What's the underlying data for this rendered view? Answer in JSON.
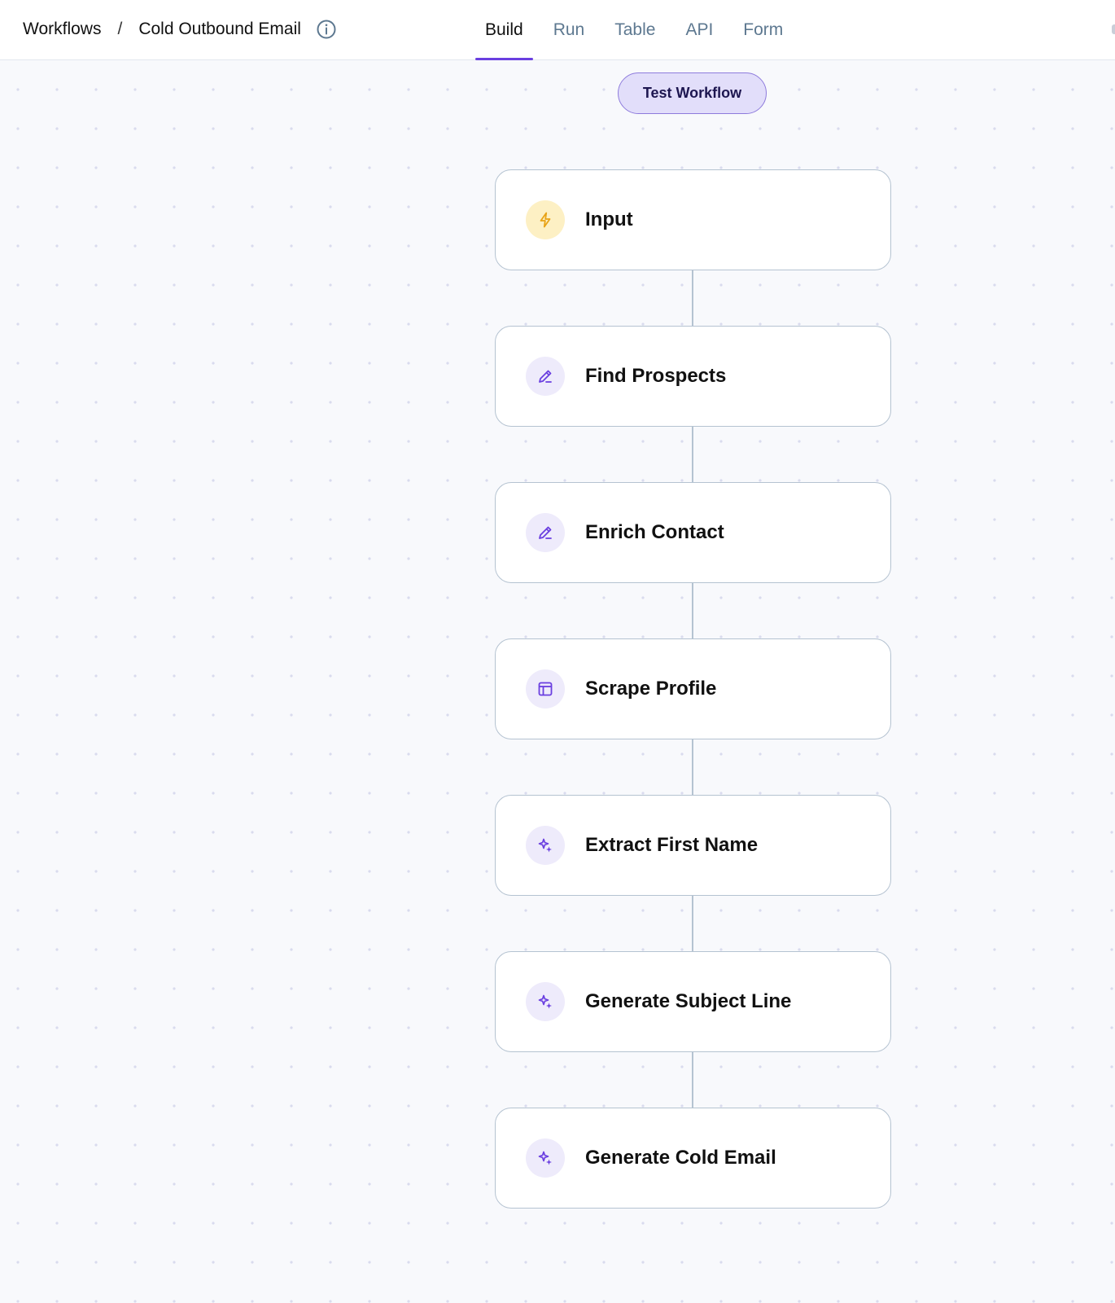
{
  "breadcrumb": {
    "root": "Workflows",
    "separator": "/",
    "current": "Cold Outbound Email",
    "info_icon": "info-circle-icon"
  },
  "tabs": [
    {
      "label": "Build",
      "active": true
    },
    {
      "label": "Run",
      "active": false
    },
    {
      "label": "Table",
      "active": false
    },
    {
      "label": "API",
      "active": false
    },
    {
      "label": "Form",
      "active": false
    }
  ],
  "test_button": {
    "label": "Test Workflow"
  },
  "nodes": [
    {
      "label": "Input",
      "icon": "lightning-icon",
      "icon_color": "#e8a317"
    },
    {
      "label": "Find Prospects",
      "icon": "pencil-icon",
      "icon_color": "#6a3fe0"
    },
    {
      "label": "Enrich Contact",
      "icon": "pencil-icon",
      "icon_color": "#6a3fe0"
    },
    {
      "label": "Scrape Profile",
      "icon": "layout-icon",
      "icon_color": "#6a3fe0"
    },
    {
      "label": "Extract First Name",
      "icon": "sparkle-icon",
      "icon_color": "#6a3fe0"
    },
    {
      "label": "Generate Subject Line",
      "icon": "sparkle-icon",
      "icon_color": "#6a3fe0"
    },
    {
      "label": "Generate Cold Email",
      "icon": "sparkle-icon",
      "icon_color": "#6a3fe0"
    }
  ],
  "colors": {
    "accent": "#6a3fe0",
    "tab_inactive": "#5d7890",
    "node_border": "#b5c3d1",
    "button_bg": "#e2defa"
  }
}
